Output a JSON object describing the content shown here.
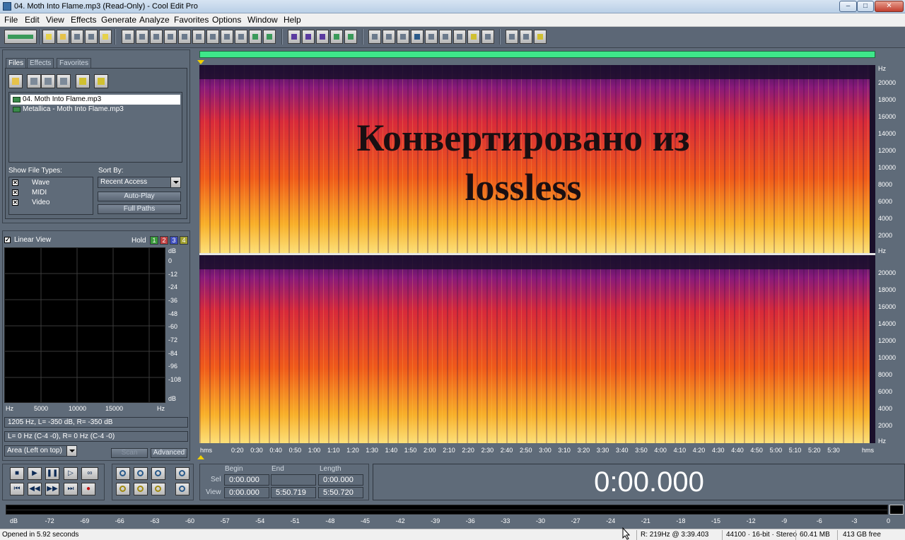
{
  "window": {
    "title": "04. Moth Into Flame.mp3 (Read-Only) - Cool Edit Pro",
    "minimize": "–",
    "maximize": "□",
    "close": "✕"
  },
  "menu": [
    "File",
    "Edit",
    "View",
    "Effects",
    "Generate",
    "Analyze",
    "Favorites",
    "Options",
    "Window",
    "Help"
  ],
  "organizer": {
    "tabs": [
      "Files",
      "Effects",
      "Favorites"
    ],
    "files": [
      "04. Moth Into Flame.mp3",
      "Metallica - Moth Into Flame.mp3"
    ],
    "show_file_types_label": "Show File Types:",
    "file_types": [
      "Wave",
      "MIDI",
      "Video"
    ],
    "sort_by_label": "Sort By:",
    "sort_by_value": "Recent Access",
    "auto_play": "Auto-Play",
    "full_paths": "Full Paths"
  },
  "frequency_analysis": {
    "linear_view": "Linear View",
    "hold": "Hold",
    "hold_buttons": [
      "1",
      "2",
      "3",
      "4"
    ],
    "db_axis": [
      "dB",
      "0",
      "-12",
      "-24",
      "-36",
      "-48",
      "-60",
      "-72",
      "-84",
      "-96",
      "-108",
      "dB"
    ],
    "hz_axis": [
      "Hz",
      "5000",
      "10000",
      "15000",
      "Hz"
    ],
    "readout1": "1205 Hz, L= -350 dB, R= -350 dB",
    "readout2": "L=      0 Hz (C-4 -0), R=      0 Hz (C-4 -0)",
    "area_select": "Area (Left on top)",
    "scan": "Scan",
    "advanced": "Advanced"
  },
  "spectral": {
    "overlay_line1": "Конвертировано из",
    "overlay_line2": "lossless",
    "hz_unit": "Hz",
    "freq_ticks": [
      "20000",
      "18000",
      "16000",
      "14000",
      "12000",
      "10000",
      "8000",
      "6000",
      "4000",
      "2000"
    ],
    "time_unit": "hms",
    "time_ticks": [
      "0:20",
      "0:30",
      "0:40",
      "0:50",
      "1:00",
      "1:10",
      "1:20",
      "1:30",
      "1:40",
      "1:50",
      "2:00",
      "2:10",
      "2:20",
      "2:30",
      "2:40",
      "2:50",
      "3:00",
      "3:10",
      "3:20",
      "3:30",
      "3:40",
      "3:50",
      "4:00",
      "4:10",
      "4:20",
      "4:30",
      "4:40",
      "4:50",
      "5:00",
      "5:10",
      "5:20",
      "5:30"
    ]
  },
  "selection": {
    "begin_label": "Begin",
    "end_label": "End",
    "length_label": "Length",
    "sel_label": "Sel",
    "view_label": "View",
    "sel_begin": "0:00.000",
    "sel_end": "",
    "sel_length": "0:00.000",
    "view_begin": "0:00.000",
    "view_end": "5:50.719",
    "view_length": "5:50.720"
  },
  "time_display": "0:00.000",
  "level_meter": [
    "dB",
    "-72",
    "-69",
    "-66",
    "-63",
    "-60",
    "-57",
    "-54",
    "-51",
    "-48",
    "-45",
    "-42",
    "-39",
    "-36",
    "-33",
    "-30",
    "-27",
    "-24",
    "-21",
    "-18",
    "-15",
    "-12",
    "-9",
    "-6",
    "-3",
    "0"
  ],
  "status": {
    "opened": "Opened in 5.92 seconds",
    "cursor": "R: 219Hz @  3:39.403",
    "format": "44100 · 16-bit · Stereo",
    "size": "60.41 MB",
    "free": "413 GB free"
  },
  "colors": {
    "overview_bar": "#3ee88a",
    "panel_bg": "#5f6b79"
  }
}
